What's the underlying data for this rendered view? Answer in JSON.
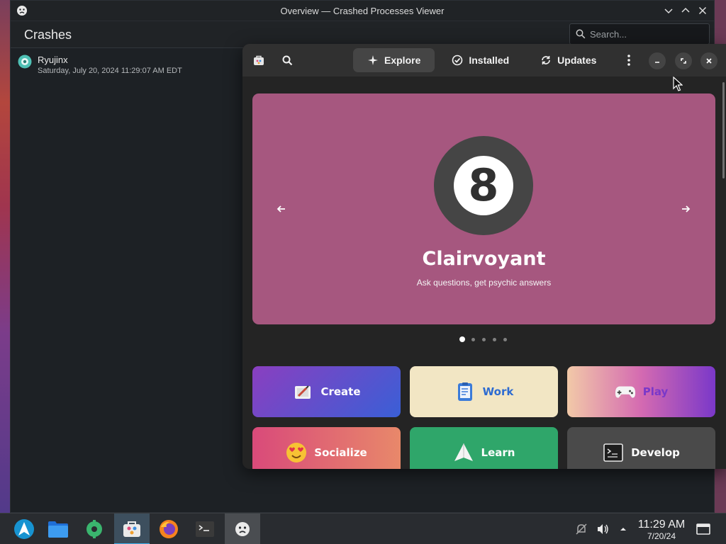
{
  "crash_viewer": {
    "window_title": "Overview — Crashed Processes Viewer",
    "page_title": "Crashes",
    "search_placeholder": "Search...",
    "crashes": [
      {
        "name": "Ryujinx",
        "date": "Saturday, July 20, 2024 11:29:07 AM EDT"
      }
    ]
  },
  "store": {
    "tabs": [
      {
        "label": "Explore",
        "icon": "sparkle-icon",
        "active": true
      },
      {
        "label": "Installed",
        "icon": "check-circle-icon",
        "active": false
      },
      {
        "label": "Updates",
        "icon": "refresh-icon",
        "active": false
      }
    ],
    "featured": {
      "app_name": "Clairvoyant",
      "tagline": "Ask questions, get psychic answers",
      "logo_glyph": "8",
      "background": "#a6577f",
      "slide_count": 5,
      "active_slide": 1
    },
    "categories": [
      {
        "label": "Create",
        "icon": "create-icon",
        "bg": "linear-gradient(135deg,#8a3fc0,#3a5fd6)",
        "color": "#ffffff"
      },
      {
        "label": "Work",
        "icon": "clipboard-icon",
        "bg": "#f2e6c4",
        "color": "#2d6bd1"
      },
      {
        "label": "Play",
        "icon": "gamepad-icon",
        "bg": "linear-gradient(90deg,#f2c9a8,#d46ab1,#7a38c9)",
        "color": "#7a38c9"
      },
      {
        "label": "Socialize",
        "icon": "smiley-hearts-icon",
        "bg": "linear-gradient(90deg,#d94a7a,#e8886a)",
        "color": "#ffffff"
      },
      {
        "label": "Learn",
        "icon": "paper-plane-icon",
        "bg": "#2fa66a",
        "color": "#ffffff"
      },
      {
        "label": "Develop",
        "icon": "terminal-icon",
        "bg": "#4a4a4a",
        "color": "#ffffff"
      }
    ]
  },
  "taskbar": {
    "time": "11:29 AM",
    "date": "7/20/24"
  },
  "colors": {
    "accent": "#3daee9",
    "hero": "#a6577f"
  }
}
